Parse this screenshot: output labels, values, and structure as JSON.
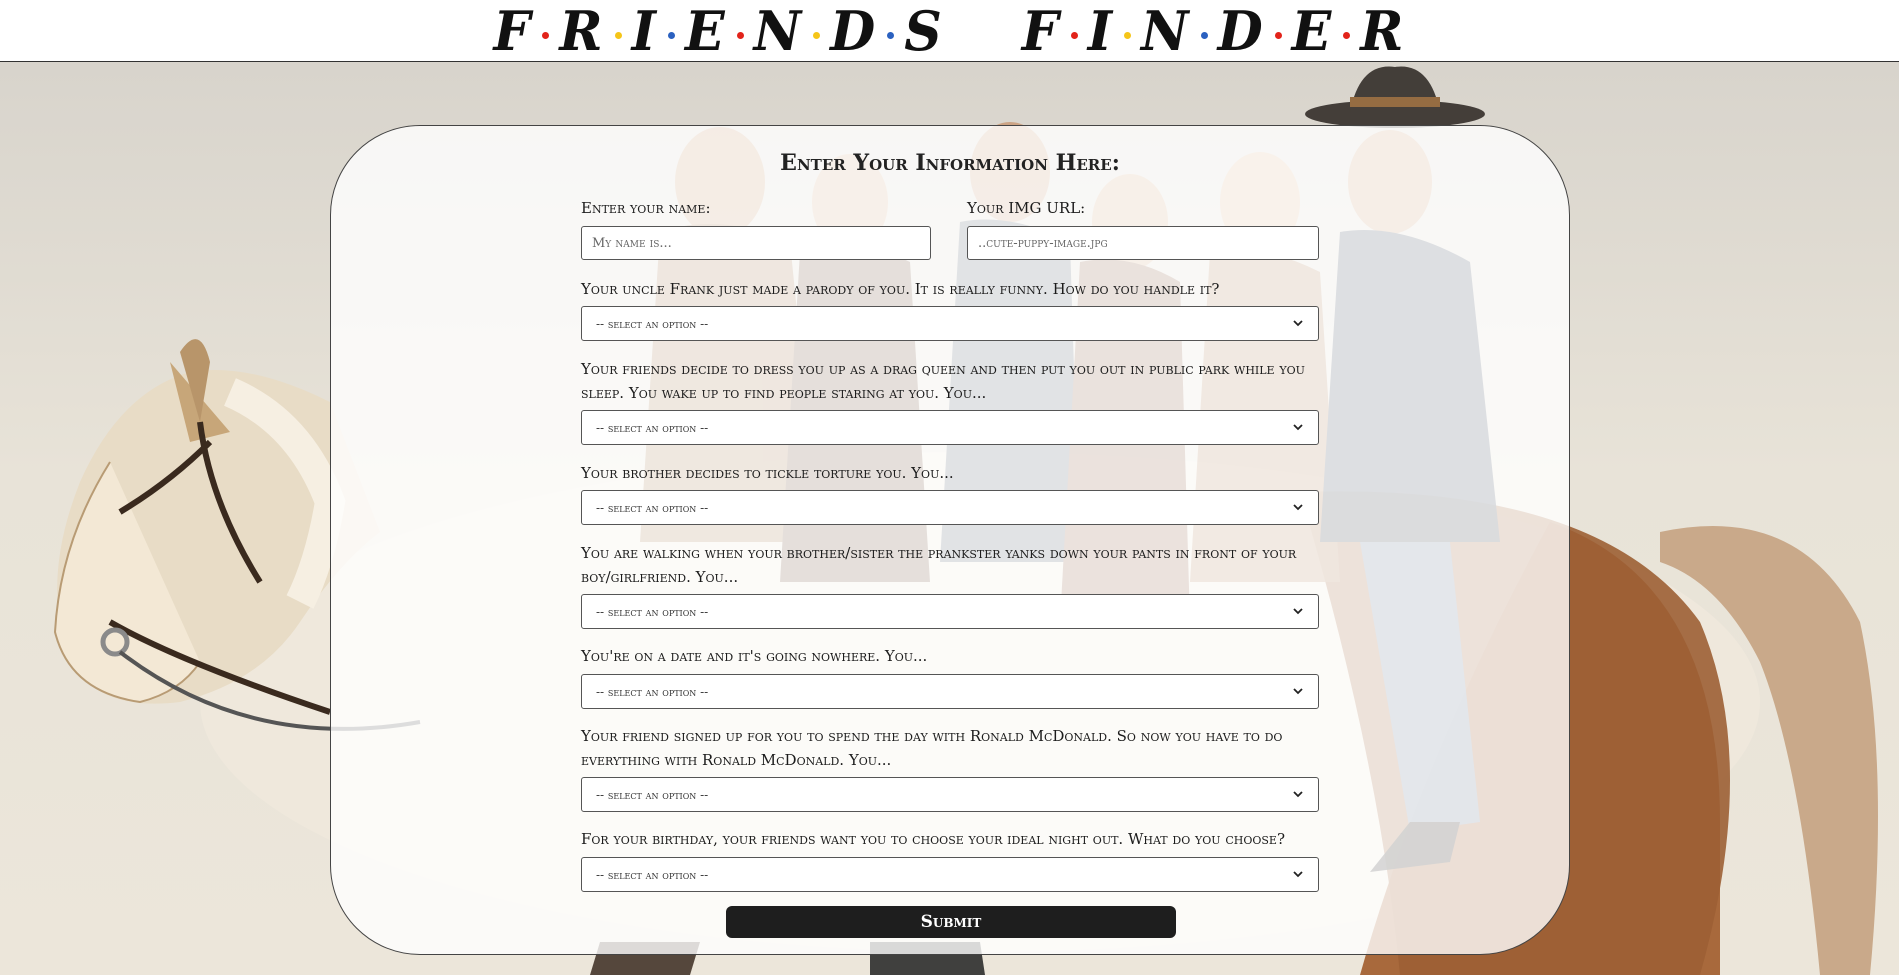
{
  "header": {
    "logo_word1": [
      "F",
      "R",
      "I",
      "E",
      "N",
      "D",
      "S"
    ],
    "logo_word2": [
      "F",
      "I",
      "N",
      "D",
      "E",
      "R"
    ],
    "dot_colors": [
      "#e2231a",
      "#f5c518",
      "#2b61c0",
      "#e2231a",
      "#f5c518",
      "#2b61c0",
      "#e2231a",
      "#f5c518",
      "#2b61c0",
      "#e2231a"
    ]
  },
  "form": {
    "title": "Enter Your Information Here:",
    "name_label": "Enter your name:",
    "name_placeholder": "My name is...",
    "img_label": "Your IMG URL:",
    "img_placeholder": "..cute-puppy-image.jpg",
    "select_placeholder": "-- select an option --",
    "questions": [
      "Your uncle Frank just made a parody of you. It is really funny. How do you handle it?",
      "Your friends decide to dress you up as a drag queen and then put you out in public park while you sleep. You wake up to find people staring at you. You...",
      "Your brother decides to tickle torture you. You...",
      "You are walking when your brother/sister the prankster yanks down your pants in front of your boy/girlfriend. You...",
      "You're on a date and it's going nowhere. You...",
      "Your friend signed up for you to spend the day with Ronald McDonald. So now you have to do everything with Ronald McDonald. You...",
      "For your birthday, your friends want you to choose your ideal night out. What do you choose?"
    ],
    "submit_label": "Submit"
  }
}
